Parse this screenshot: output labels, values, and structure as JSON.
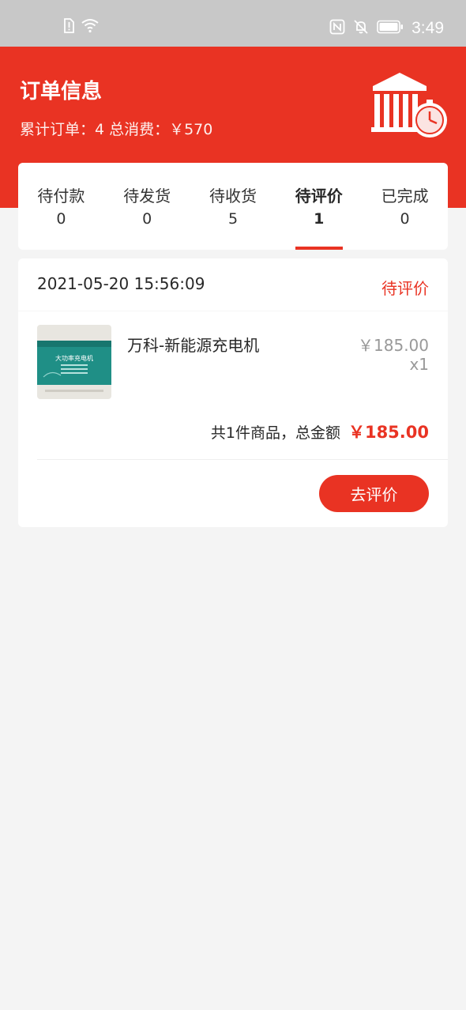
{
  "status_bar": {
    "time": "3:49",
    "icons": [
      "sim-alert-icon",
      "wifi-icon",
      "nfc-icon",
      "bell-off-icon",
      "battery-icon"
    ]
  },
  "header": {
    "title": "订单信息",
    "summary_orders_label": "累计订单：4",
    "summary_spend_label": "总消费：￥570"
  },
  "tabs": [
    {
      "label": "待付款",
      "count": "0",
      "active": false
    },
    {
      "label": "待发货",
      "count": "0",
      "active": false
    },
    {
      "label": "待收货",
      "count": "5",
      "active": false
    },
    {
      "label": "待评价",
      "count": "1",
      "active": true
    },
    {
      "label": "已完成",
      "count": "0",
      "active": false
    }
  ],
  "order": {
    "datetime": "2021-05-20 15:56:09",
    "status": "待评价",
    "product": {
      "name": "万科-新能源充电机",
      "price": "￥185.00",
      "quantity": "x1",
      "thumb_text": "大功率充电机"
    },
    "total_label": "共1件商品，总金额",
    "total_amount": "￥185.00",
    "action_label": "去评价"
  },
  "colors": {
    "accent": "#e93323",
    "background": "#f4f4f4",
    "status_bar": "#c8c8c8"
  }
}
